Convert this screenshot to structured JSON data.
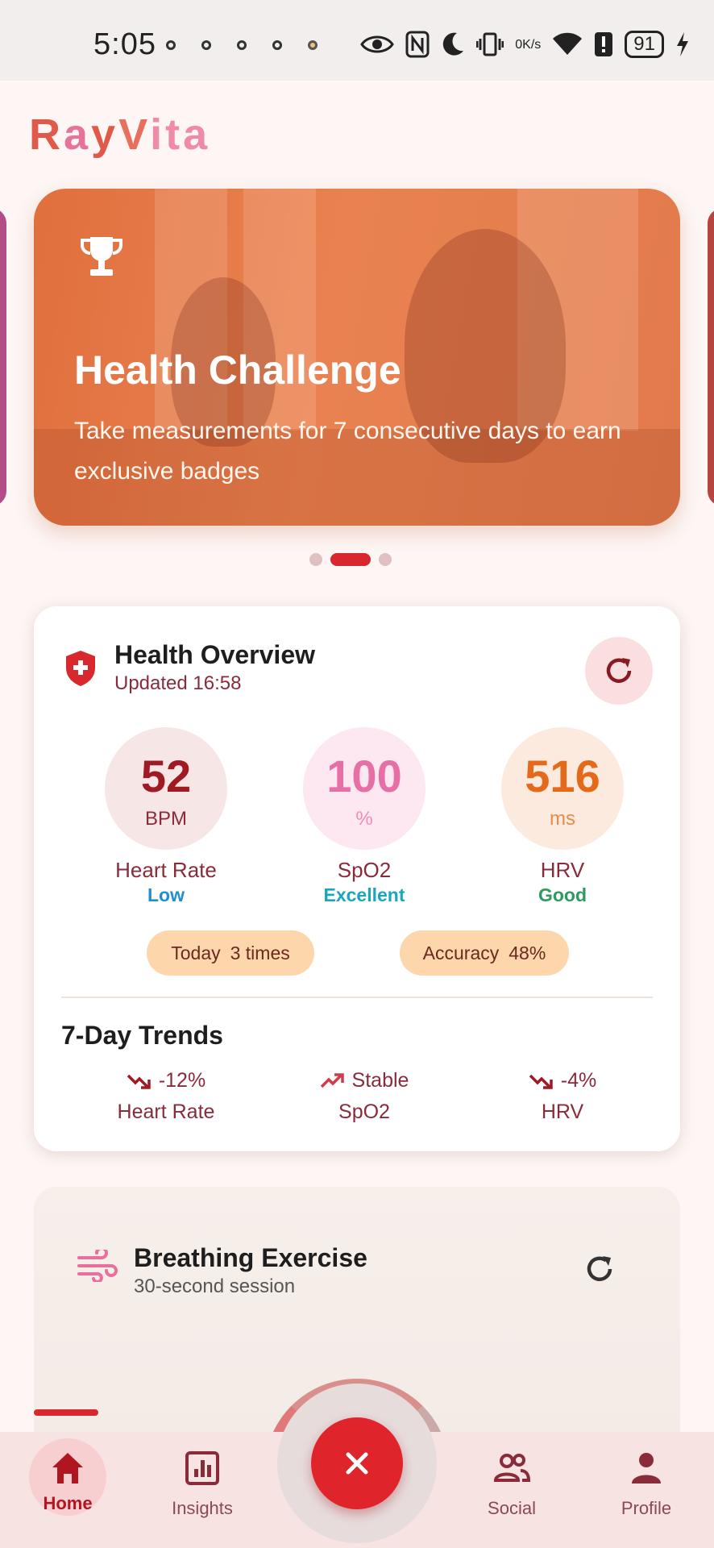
{
  "status_bar": {
    "time": "5:05",
    "network_rate_value": "0",
    "network_rate_unit": "K/s",
    "battery": "91"
  },
  "app": {
    "logo_text": "RayVita",
    "brand_color": "#d8282e"
  },
  "carousel": {
    "active_index": 1,
    "count": 3,
    "current": {
      "icon": "trophy-icon",
      "title": "Health Challenge",
      "description": "Take measurements for 7 consecutive days to earn exclusive badges"
    }
  },
  "health_overview": {
    "title": "Health Overview",
    "updated": "Updated 16:58",
    "metrics": [
      {
        "value": "52",
        "unit": "BPM",
        "name": "Heart Rate",
        "status": "Low"
      },
      {
        "value": "100",
        "unit": "%",
        "name": "SpO2",
        "status": "Excellent"
      },
      {
        "value": "516",
        "unit": "ms",
        "name": "HRV",
        "status": "Good"
      }
    ],
    "today_label": "Today",
    "today_value": "3 times",
    "accuracy_label": "Accuracy",
    "accuracy_value": "48%",
    "trends_title": "7-Day Trends",
    "trends": [
      {
        "direction": "down",
        "value": "-12%",
        "label": "Heart Rate"
      },
      {
        "direction": "up",
        "value": "Stable",
        "label": "SpO2"
      },
      {
        "direction": "down",
        "value": "-4%",
        "label": "HRV"
      }
    ]
  },
  "breathing": {
    "title": "Breathing Exercise",
    "subtitle": "30-second session"
  },
  "bottom_nav": {
    "items": [
      {
        "label": "Home",
        "icon": "home-icon",
        "active": true
      },
      {
        "label": "Insights",
        "icon": "chart-icon",
        "active": false
      },
      {
        "label": "Social",
        "icon": "people-icon",
        "active": false
      },
      {
        "label": "Profile",
        "icon": "person-icon",
        "active": false
      }
    ],
    "fab_icon": "close-icon"
  }
}
